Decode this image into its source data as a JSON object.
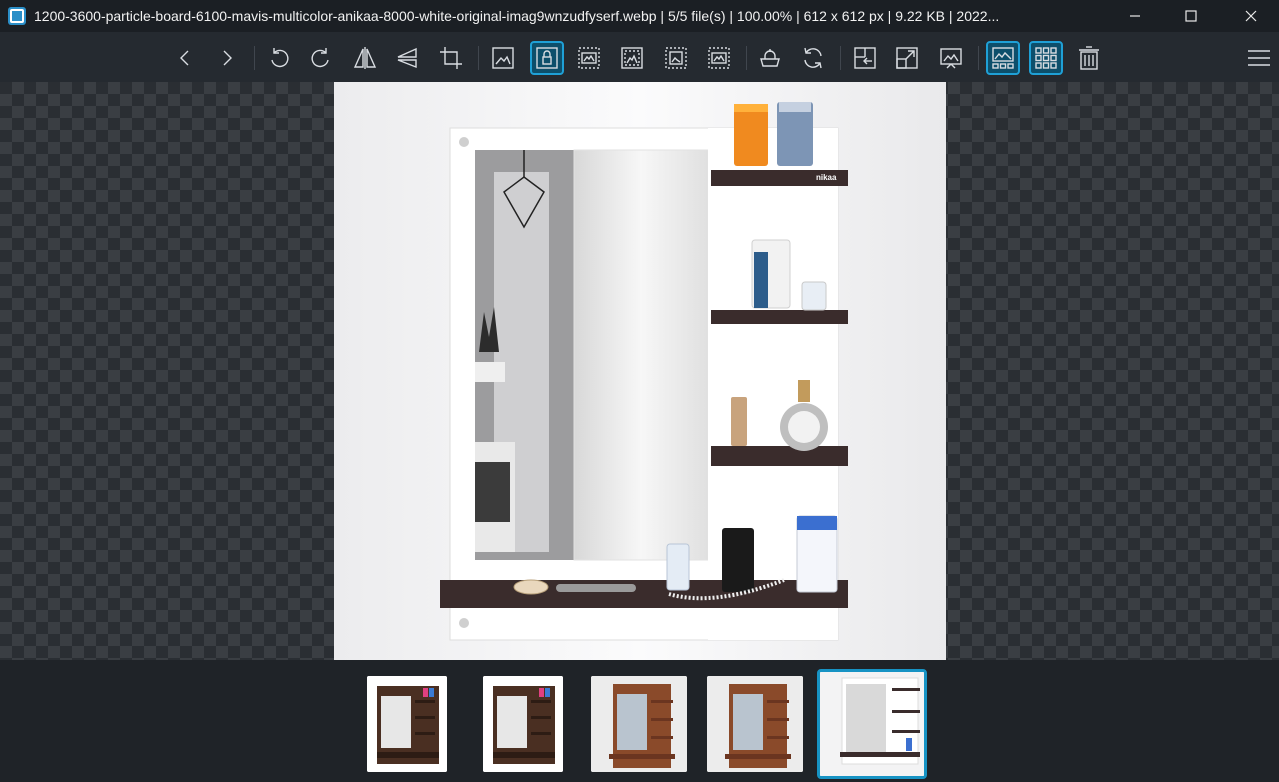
{
  "window": {
    "title": "1200-3600-particle-board-6100-mavis-multicolor-anikaa-8000-white-original-imag9wnzudfyserf.webp  |  5/5 file(s)  |  100.00%  |  612 x 612 px  |  9.22 KB  |  2022...",
    "app_icon": "image-viewer-icon",
    "controls": [
      "minimize-icon",
      "maximize-icon",
      "close-icon"
    ]
  },
  "toolbar": {
    "buttons": [
      {
        "icon": "previous-icon",
        "active": false
      },
      {
        "icon": "next-icon",
        "active": false
      },
      {
        "icon": "rotate-left-icon",
        "active": false
      },
      {
        "icon": "rotate-right-icon",
        "active": false
      },
      {
        "icon": "flip-horizontal-icon",
        "active": false
      },
      {
        "icon": "flip-vertical-icon",
        "active": false
      },
      {
        "icon": "crop-icon",
        "active": false
      },
      {
        "icon": "actual-size-icon",
        "active": false
      },
      {
        "icon": "lock-zoom-icon",
        "active": true
      },
      {
        "icon": "scale-to-width-icon",
        "active": false
      },
      {
        "icon": "scale-to-height-icon",
        "active": false
      },
      {
        "icon": "scale-to-fit-icon",
        "active": false
      },
      {
        "icon": "scale-to-fill-icon",
        "active": false
      },
      {
        "icon": "checkerboard-icon",
        "active": false
      },
      {
        "icon": "refresh-icon",
        "active": false
      },
      {
        "icon": "open-location-icon",
        "active": false
      },
      {
        "icon": "fullscreen-icon",
        "active": false
      },
      {
        "icon": "slideshow-icon",
        "active": false
      },
      {
        "icon": "thumbnail-bar-icon",
        "active": true
      },
      {
        "icon": "gallery-icon",
        "active": true
      },
      {
        "icon": "delete-icon",
        "active": false
      },
      {
        "icon": "main-menu-icon",
        "active": false
      }
    ]
  },
  "viewer": {
    "brand_logo_text": "nikaa"
  },
  "thumbnails": [
    {
      "variant": "brown",
      "selected": false
    },
    {
      "variant": "brown",
      "selected": false
    },
    {
      "variant": "brown-wall",
      "selected": false
    },
    {
      "variant": "brown-wall",
      "selected": false
    },
    {
      "variant": "white",
      "selected": true
    }
  ],
  "colors": {
    "accent": "#1793c4",
    "active_bg": "#0d4f6b",
    "shelf": "#3a2c2c",
    "frame": "#ffffff"
  }
}
